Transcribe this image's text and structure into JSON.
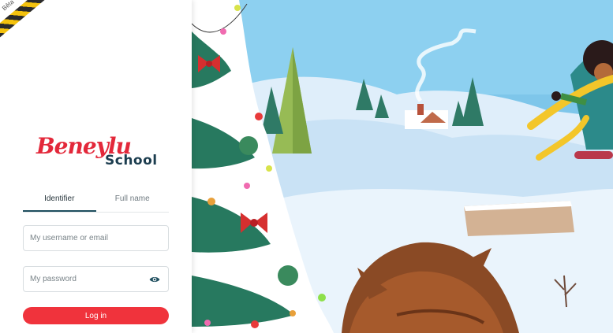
{
  "beta_label": "Bêta",
  "logo": {
    "brand": "Beneylu",
    "school": "School"
  },
  "tabs": [
    {
      "label": "Identifier",
      "active": true
    },
    {
      "label": "Full name",
      "active": false
    }
  ],
  "form": {
    "username_placeholder": "My username or email",
    "password_placeholder": "My password",
    "login_label": "Log in"
  },
  "colors": {
    "accent": "#f0333c",
    "brand_red": "#e3283a",
    "brand_dark": "#1c3d4f",
    "tab_active": "#1f4f5f"
  },
  "icons": {
    "password_toggle": "eye-icon"
  }
}
